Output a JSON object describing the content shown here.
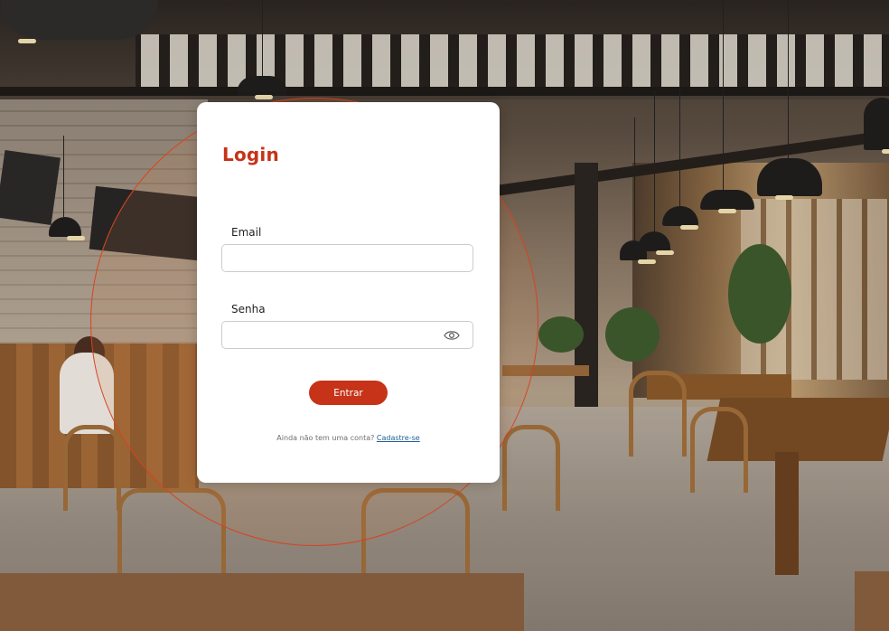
{
  "login": {
    "title": "Login",
    "email_label": "Email",
    "email_value": "",
    "password_label": "Senha",
    "password_value": "",
    "submit_label": "Entrar",
    "signup_prompt": "Ainda não tem uma conta?",
    "signup_link": "Cadastre-se"
  },
  "icons": {
    "password_toggle": "eye-icon"
  },
  "colors": {
    "accent": "#c63318",
    "link": "#1f5d95",
    "card_bg": "#ffffff"
  }
}
